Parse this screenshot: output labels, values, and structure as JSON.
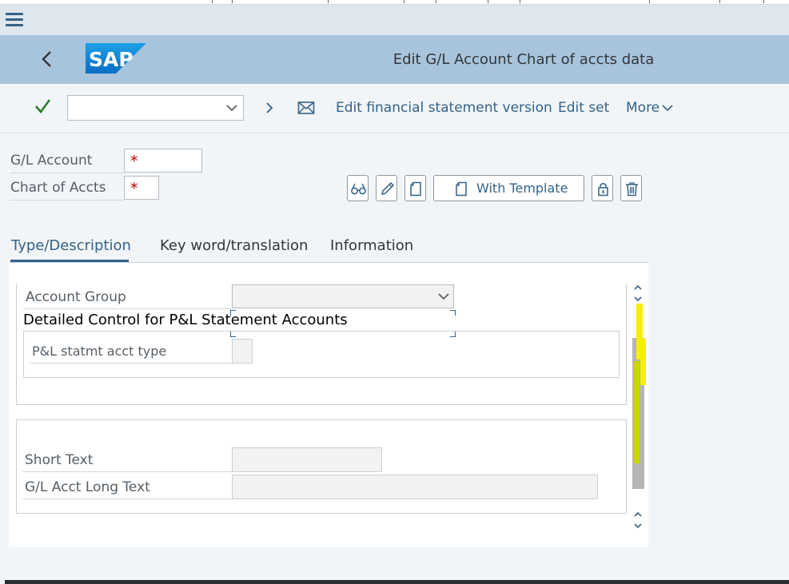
{
  "header": {
    "title": "Edit G/L Account Chart of accts data",
    "logo_text": "SAP"
  },
  "colors": {
    "shell": "#a8c4dc",
    "accent": "#346187",
    "required": "#bb0000",
    "check": "#2b7d2b"
  },
  "toolbar": {
    "command_value": "",
    "edit_fs_version": "Edit financial statement version",
    "edit_set": "Edit set",
    "more": "More"
  },
  "fields": {
    "gl_account_label": "G/L Account",
    "gl_account_required": "*",
    "chart_label": "Chart of Accts",
    "chart_required": "*"
  },
  "actions": {
    "with_template": "With Template",
    "icons": [
      "glasses-icon",
      "pencil-icon",
      "document-icon",
      "lock-icon",
      "trash-icon"
    ]
  },
  "tabs": [
    {
      "label": "Type/Description",
      "active": true
    },
    {
      "label": "Key word/translation",
      "active": false
    },
    {
      "label": "Information",
      "active": false
    }
  ],
  "control": {
    "account_group_label": "Account Group",
    "account_group_value": "",
    "pl_group_title": "Detailed Control for P&L Statement Accounts",
    "pl_type_label": "P&L statmt acct type",
    "pl_type_value": ""
  },
  "description": {
    "short_text_label": "Short Text",
    "short_text_value": "",
    "long_text_label": "G/L Acct Long Text",
    "long_text_value": ""
  }
}
